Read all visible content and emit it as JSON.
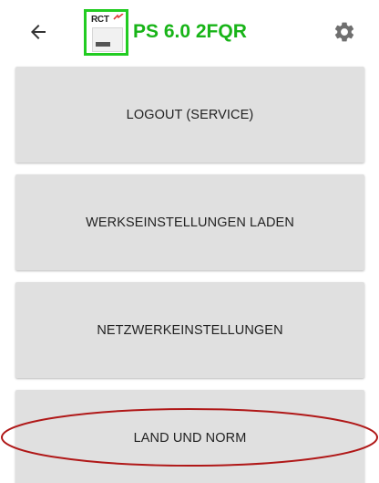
{
  "appbar": {
    "back_icon": "arrow-left-icon",
    "logo": {
      "brand_text": "RCT",
      "border_color": "#22cc22"
    },
    "title": "PS 6.0 2FQR",
    "title_color": "#18b418",
    "settings_icon": "gear-icon"
  },
  "menu": {
    "items": [
      {
        "label": "LOGOUT (SERVICE)"
      },
      {
        "label": "WERKSEINSTELLUNGEN LADEN"
      },
      {
        "label": "NETZWERKEINSTELLUNGEN"
      },
      {
        "label": "LAND UND NORM"
      }
    ]
  },
  "annotation": {
    "shape": "ellipse",
    "color": "#b01818",
    "highlights": "LAND UND NORM"
  }
}
